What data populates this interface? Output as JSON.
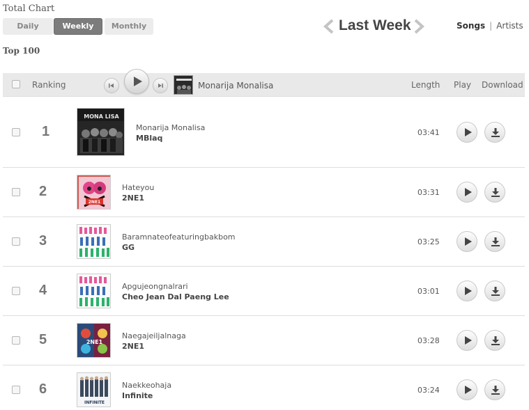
{
  "page": {
    "title": "Total Chart",
    "section_title": "Top 100"
  },
  "tabs": [
    {
      "label": "Daily",
      "active": false
    },
    {
      "label": "Weekly",
      "active": true
    },
    {
      "label": "Monthly",
      "active": false
    }
  ],
  "period": {
    "label": "Last Week",
    "prev_icon": "chevron-left-icon",
    "next_icon": "chevron-right-icon"
  },
  "view_toggle": {
    "songs": "Songs",
    "separator": "|",
    "artists": "Artists",
    "active": "Songs"
  },
  "header": {
    "ranking": "Ranking",
    "now_playing_title": "Monarija Monalisa",
    "columns": {
      "length": "Length",
      "play": "Play",
      "download": "Download"
    }
  },
  "tracks": [
    {
      "rank": "1",
      "title": "Monarija Monalisa",
      "artist": "MBlaq",
      "length": "03:41",
      "cover": "monalisa"
    },
    {
      "rank": "2",
      "title": "Hateyou",
      "artist": "2NE1",
      "length": "03:31",
      "cover": "hateyou"
    },
    {
      "rank": "3",
      "title": "Baramnateofeaturingbakbom",
      "artist": "GG",
      "length": "03:25",
      "cover": "gg"
    },
    {
      "rank": "4",
      "title": "Apgujeongnalrari",
      "artist": "Cheo Jean Dal Paeng Lee",
      "length": "03:01",
      "cover": "gg"
    },
    {
      "rank": "5",
      "title": "Naegajeiljalnaga",
      "artist": "2NE1",
      "length": "03:28",
      "cover": "2ne1"
    },
    {
      "rank": "6",
      "title": "Naekkeohaja",
      "artist": "Infinite",
      "length": "03:24",
      "cover": "infinite"
    }
  ],
  "cover_text": {
    "monalisa": "MONA LISA",
    "hateyou": "2NE1",
    "2ne1": "2NE1",
    "infinite": "INFINITE"
  },
  "colors": {
    "active_tab": "#7c7c7c",
    "header_bar": "#e9e9e9",
    "rank_text": "#777777"
  }
}
